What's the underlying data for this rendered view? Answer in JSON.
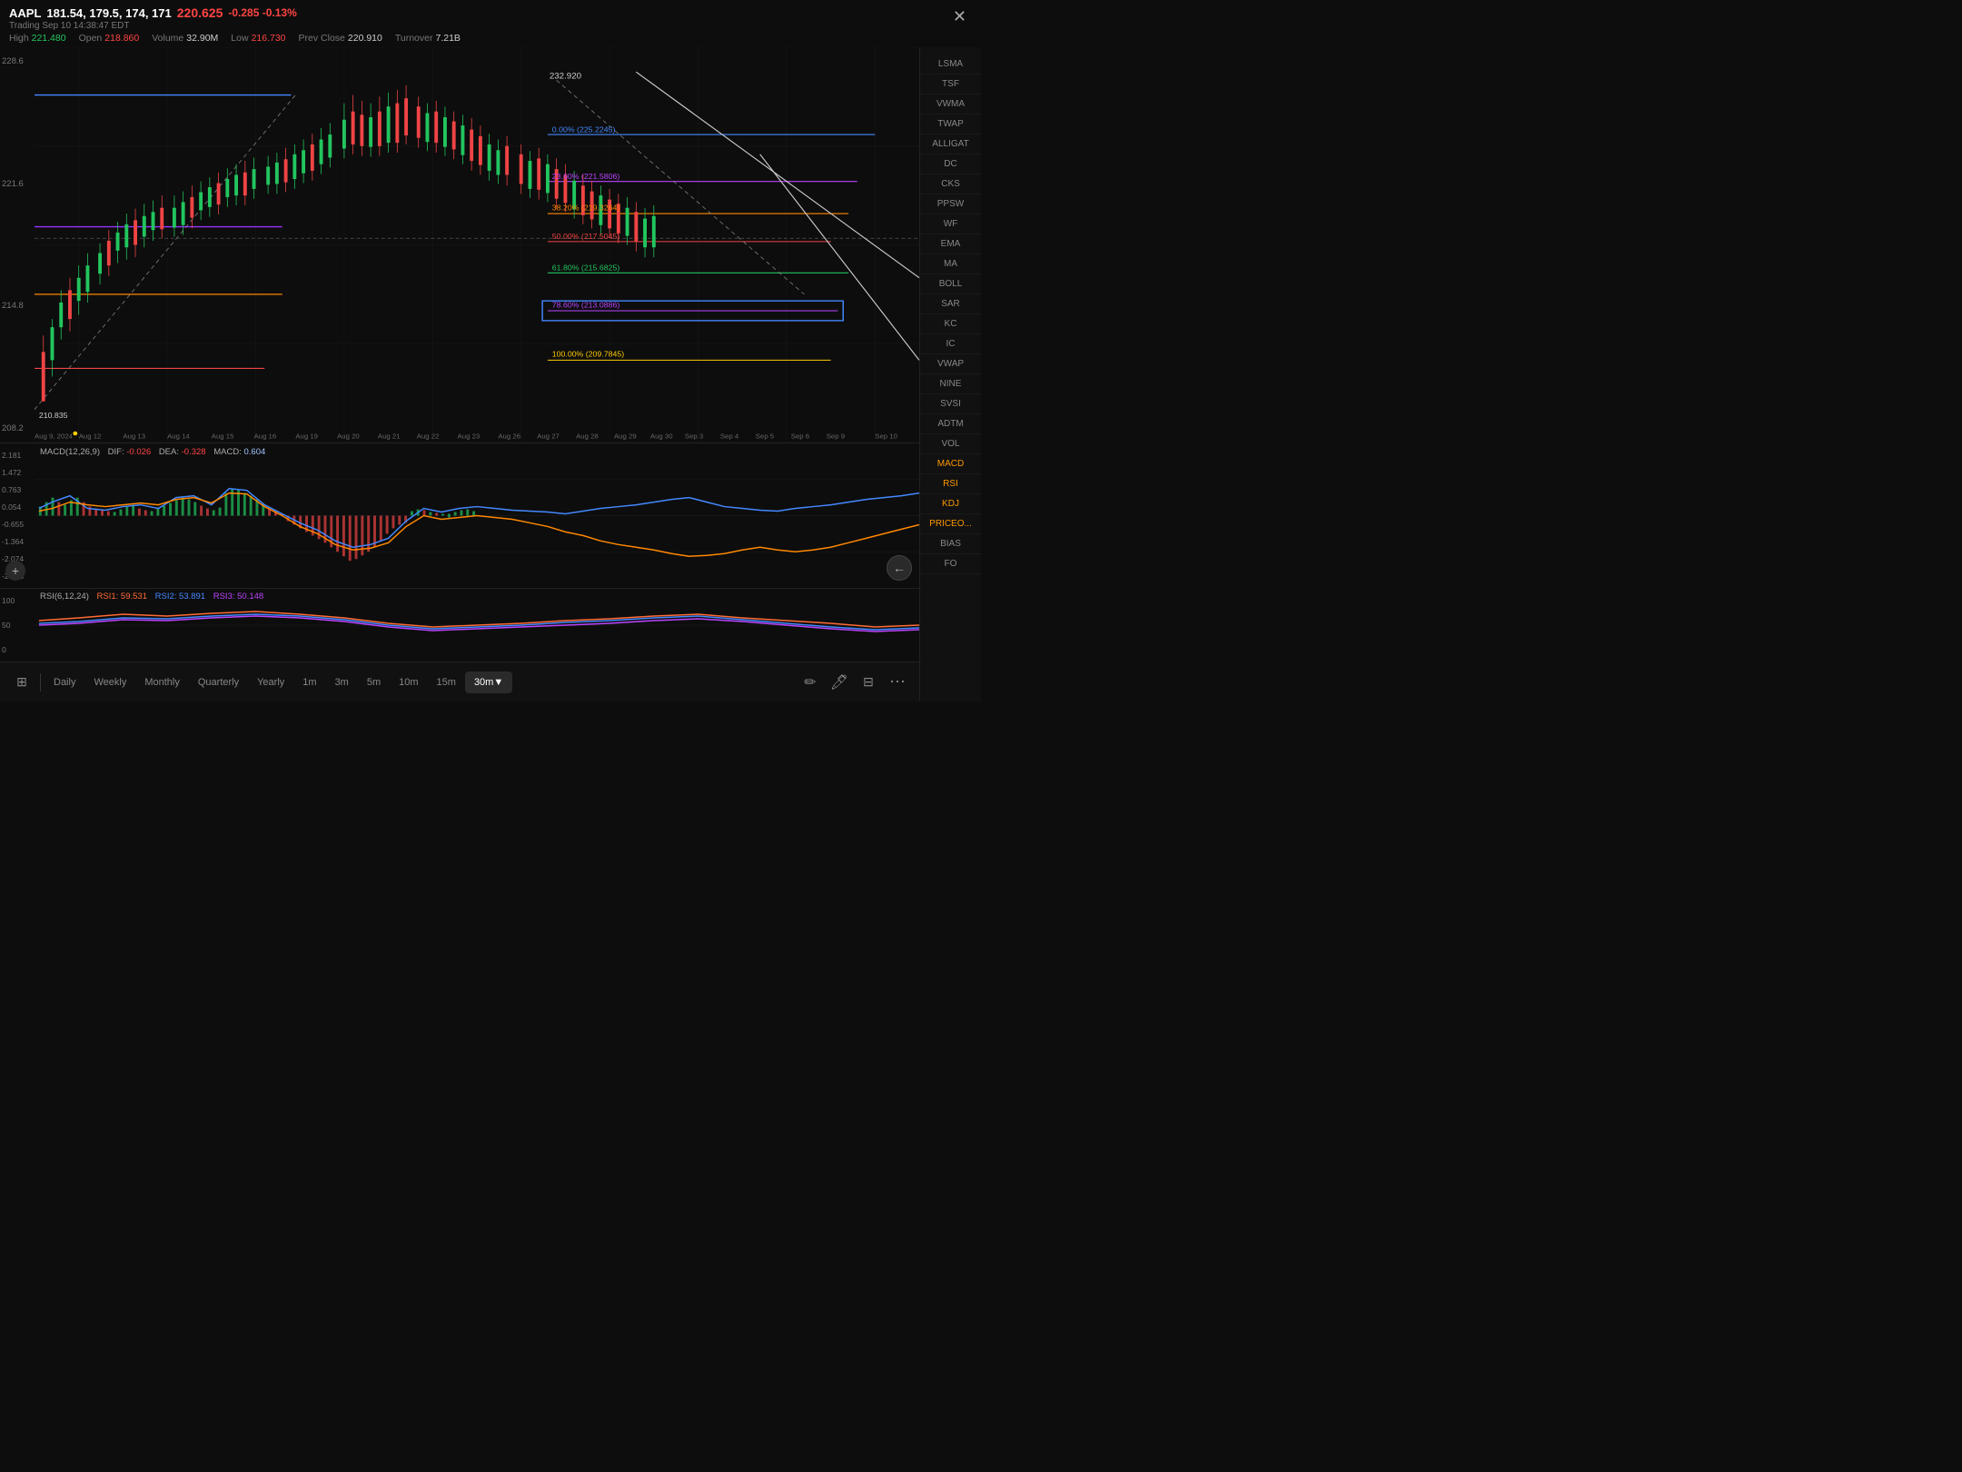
{
  "header": {
    "ticker": "AAPL",
    "ohlc": "181.54, 179.5, 174, 171",
    "price": "220.625",
    "change": "-0.285",
    "change_pct": "-0.13%",
    "trading_time": "Trading Sep 10 14:38:47 EDT",
    "high_label": "High",
    "high_val": "221.480",
    "open_label": "Open",
    "open_val": "218.860",
    "volume_label": "Volume",
    "volume_val": "32.90M",
    "low_label": "Low",
    "low_val": "216.730",
    "prev_close_label": "Prev Close",
    "prev_close_val": "220.910",
    "turnover_label": "Turnover",
    "turnover_val": "7.21B"
  },
  "price_levels": {
    "top": "228.6",
    "mid1": "221.6",
    "mid2": "214.8",
    "bottom": "208.2",
    "last_price": "210.835"
  },
  "fibonacci": {
    "level0": {
      "pct": "0.00%",
      "val": "225.2245",
      "color": "#4488ff",
      "yPct": 22
    },
    "level1": {
      "pct": "23.60%",
      "val": "221.5806",
      "color": "#bb44ff",
      "yPct": 34
    },
    "level2": {
      "pct": "38.20%",
      "val": "219.3264",
      "color": "#ff8800",
      "yPct": 42
    },
    "level3": {
      "pct": "50.00%",
      "val": "217.5045",
      "color": "#ef4444",
      "yPct": 49
    },
    "level4": {
      "pct": "61.80%",
      "val": "215.6825",
      "color": "#22c55e",
      "yPct": 57
    },
    "level5": {
      "pct": "78.60%",
      "val": "213.0886",
      "color": "#bb44ff",
      "yPct": 67,
      "boxed": true
    },
    "level6": {
      "pct": "100.00%",
      "val": "209.7845",
      "color": "#ffcc00",
      "yPct": 79
    }
  },
  "macd": {
    "title": "MACD(12,26,9)",
    "dif_label": "DIF:",
    "dif_val": "-0.026",
    "dea_label": "DEA:",
    "dea_val": "-0.328",
    "macd_label": "MACD:",
    "macd_val": "0.604",
    "levels": [
      "2.181",
      "1.472",
      "0.763",
      "0.054",
      "-0.655",
      "-1.364",
      "-2.074",
      "-2.783"
    ]
  },
  "rsi": {
    "title": "RSI(6,12,24)",
    "rsi1_label": "RSI1:",
    "rsi1_val": "59.531",
    "rsi2_label": "RSI2:",
    "rsi2_val": "53.891",
    "rsi3_label": "RSI3:",
    "rsi3_val": "50.148"
  },
  "dates": [
    "Aug 9, 2024",
    "Aug 12",
    "Aug 13",
    "Aug 14",
    "Aug 15",
    "Aug 16",
    "Aug 19",
    "Aug 20",
    "Aug 21",
    "Aug 22",
    "Aug 23",
    "Aug 26",
    "Aug 27",
    "Aug 28",
    "Aug 29",
    "Aug 30",
    "Sep 3",
    "Sep 4",
    "Sep 5",
    "Sep 6",
    "Sep 9",
    "Sep 10"
  ],
  "sidebar_items": [
    "LSMA",
    "TSF",
    "VWMA",
    "TWAP",
    "ALLIGAT",
    "DC",
    "CKS",
    "PPSW",
    "WF",
    "EMA",
    "MA",
    "BOLL",
    "SAR",
    "KC",
    "IC",
    "VWAP",
    "NINE",
    "SVSI",
    "ADTM",
    "VOL",
    "MACD",
    "RSI",
    "KDJ",
    "PRICEO...",
    "BIAS",
    "FO"
  ],
  "sidebar_active": [
    "MACD",
    "RSI",
    "KDJ",
    "PRICEO..."
  ],
  "toolbar": {
    "layout_icon": "⊞",
    "daily": "Daily",
    "weekly": "Weekly",
    "monthly": "Monthly",
    "quarterly": "Quarterly",
    "yearly": "Yearly",
    "1m": "1m",
    "3m": "3m",
    "5m": "5m",
    "10m": "10m",
    "15m": "15m",
    "30m": "30m▼",
    "draw_icon": "✏",
    "pen_icon": "🖊",
    "indicator_icon": "⊞",
    "more_icon": "⋯"
  }
}
